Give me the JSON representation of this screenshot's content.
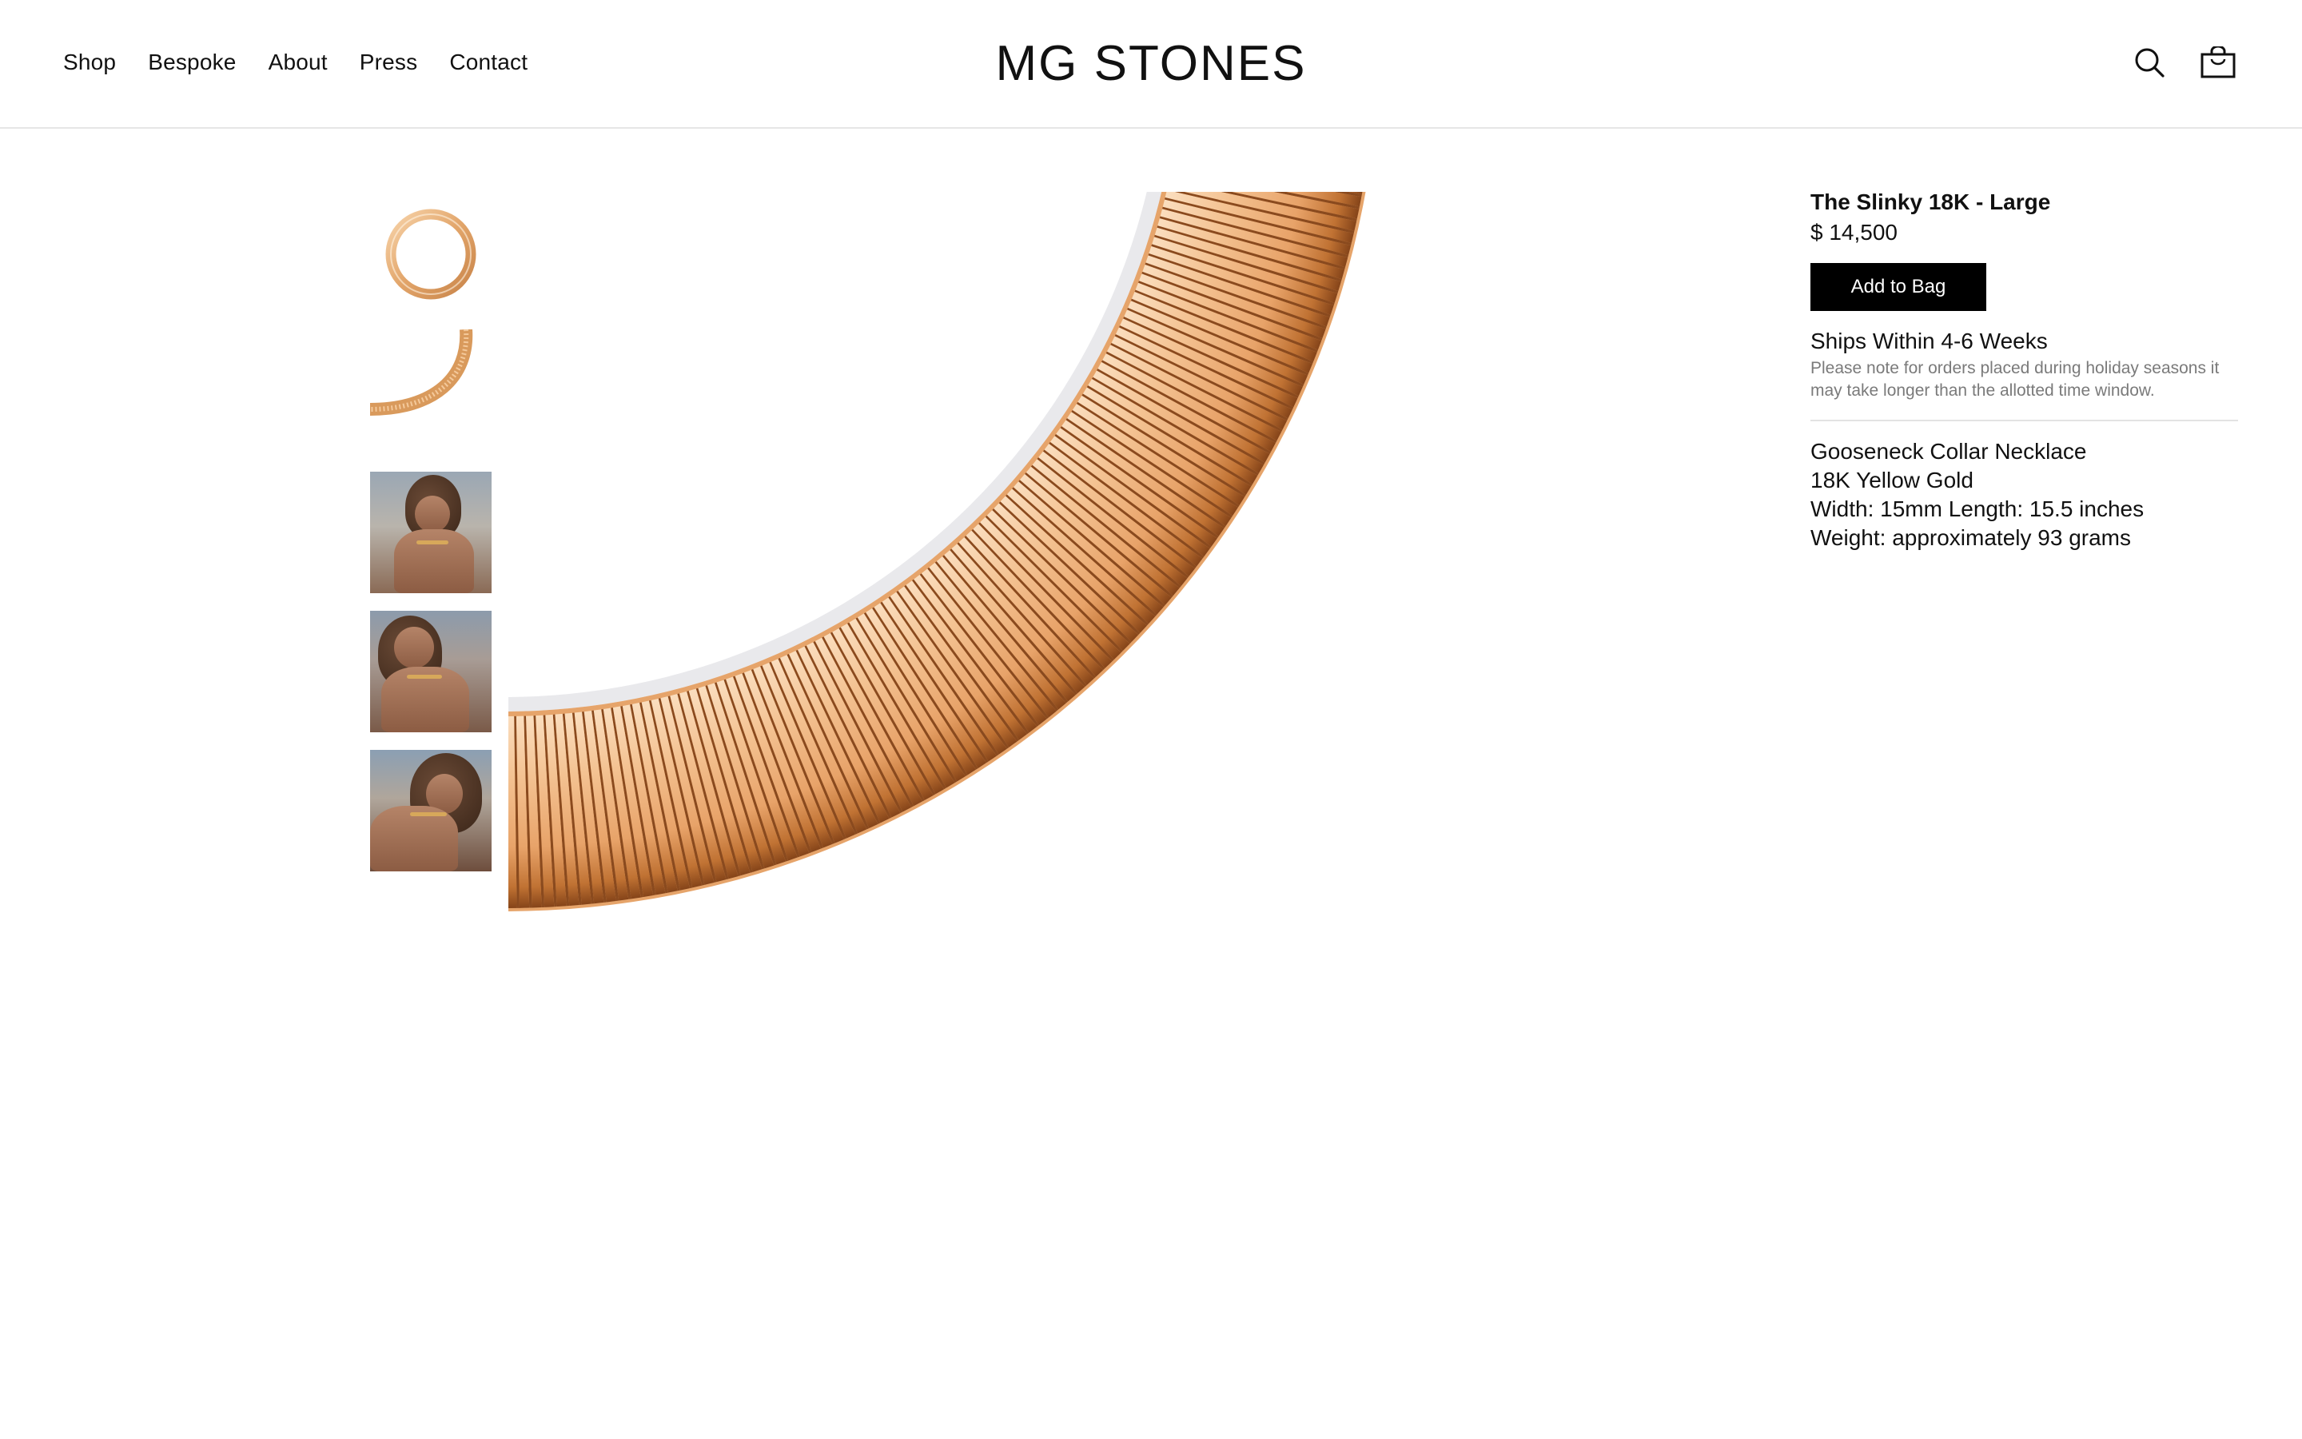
{
  "header": {
    "nav": [
      "Shop",
      "Bespoke",
      "About",
      "Press",
      "Contact"
    ],
    "logo": "MG STONES",
    "icons": [
      "search-icon",
      "shopping-bag-icon"
    ]
  },
  "gallery": {
    "thumbnails": [
      "ring-product-view",
      "necklace-detail-view",
      "model-photo-1",
      "model-photo-2",
      "model-photo-3"
    ],
    "main_image": "gold-gooseneck-collar-necklace"
  },
  "product": {
    "title": "The Slinky 18K - Large",
    "price": "$ 14,500",
    "add_to_bag": "Add to Bag",
    "ships_title": "Ships Within 4-6 Weeks",
    "ships_note": "Please note for orders placed during holiday seasons it may take longer than the allotted time window.",
    "details": [
      "Gooseneck Collar Necklace",
      "18K Yellow Gold",
      "Width: 15mm Length: 15.5 inches",
      "Weight: approximately 93 grams"
    ]
  },
  "colors": {
    "gold_light": "#f3c394",
    "gold_mid": "#e09a5e",
    "gold_dark": "#8a4a1e",
    "button_bg": "#000000"
  }
}
